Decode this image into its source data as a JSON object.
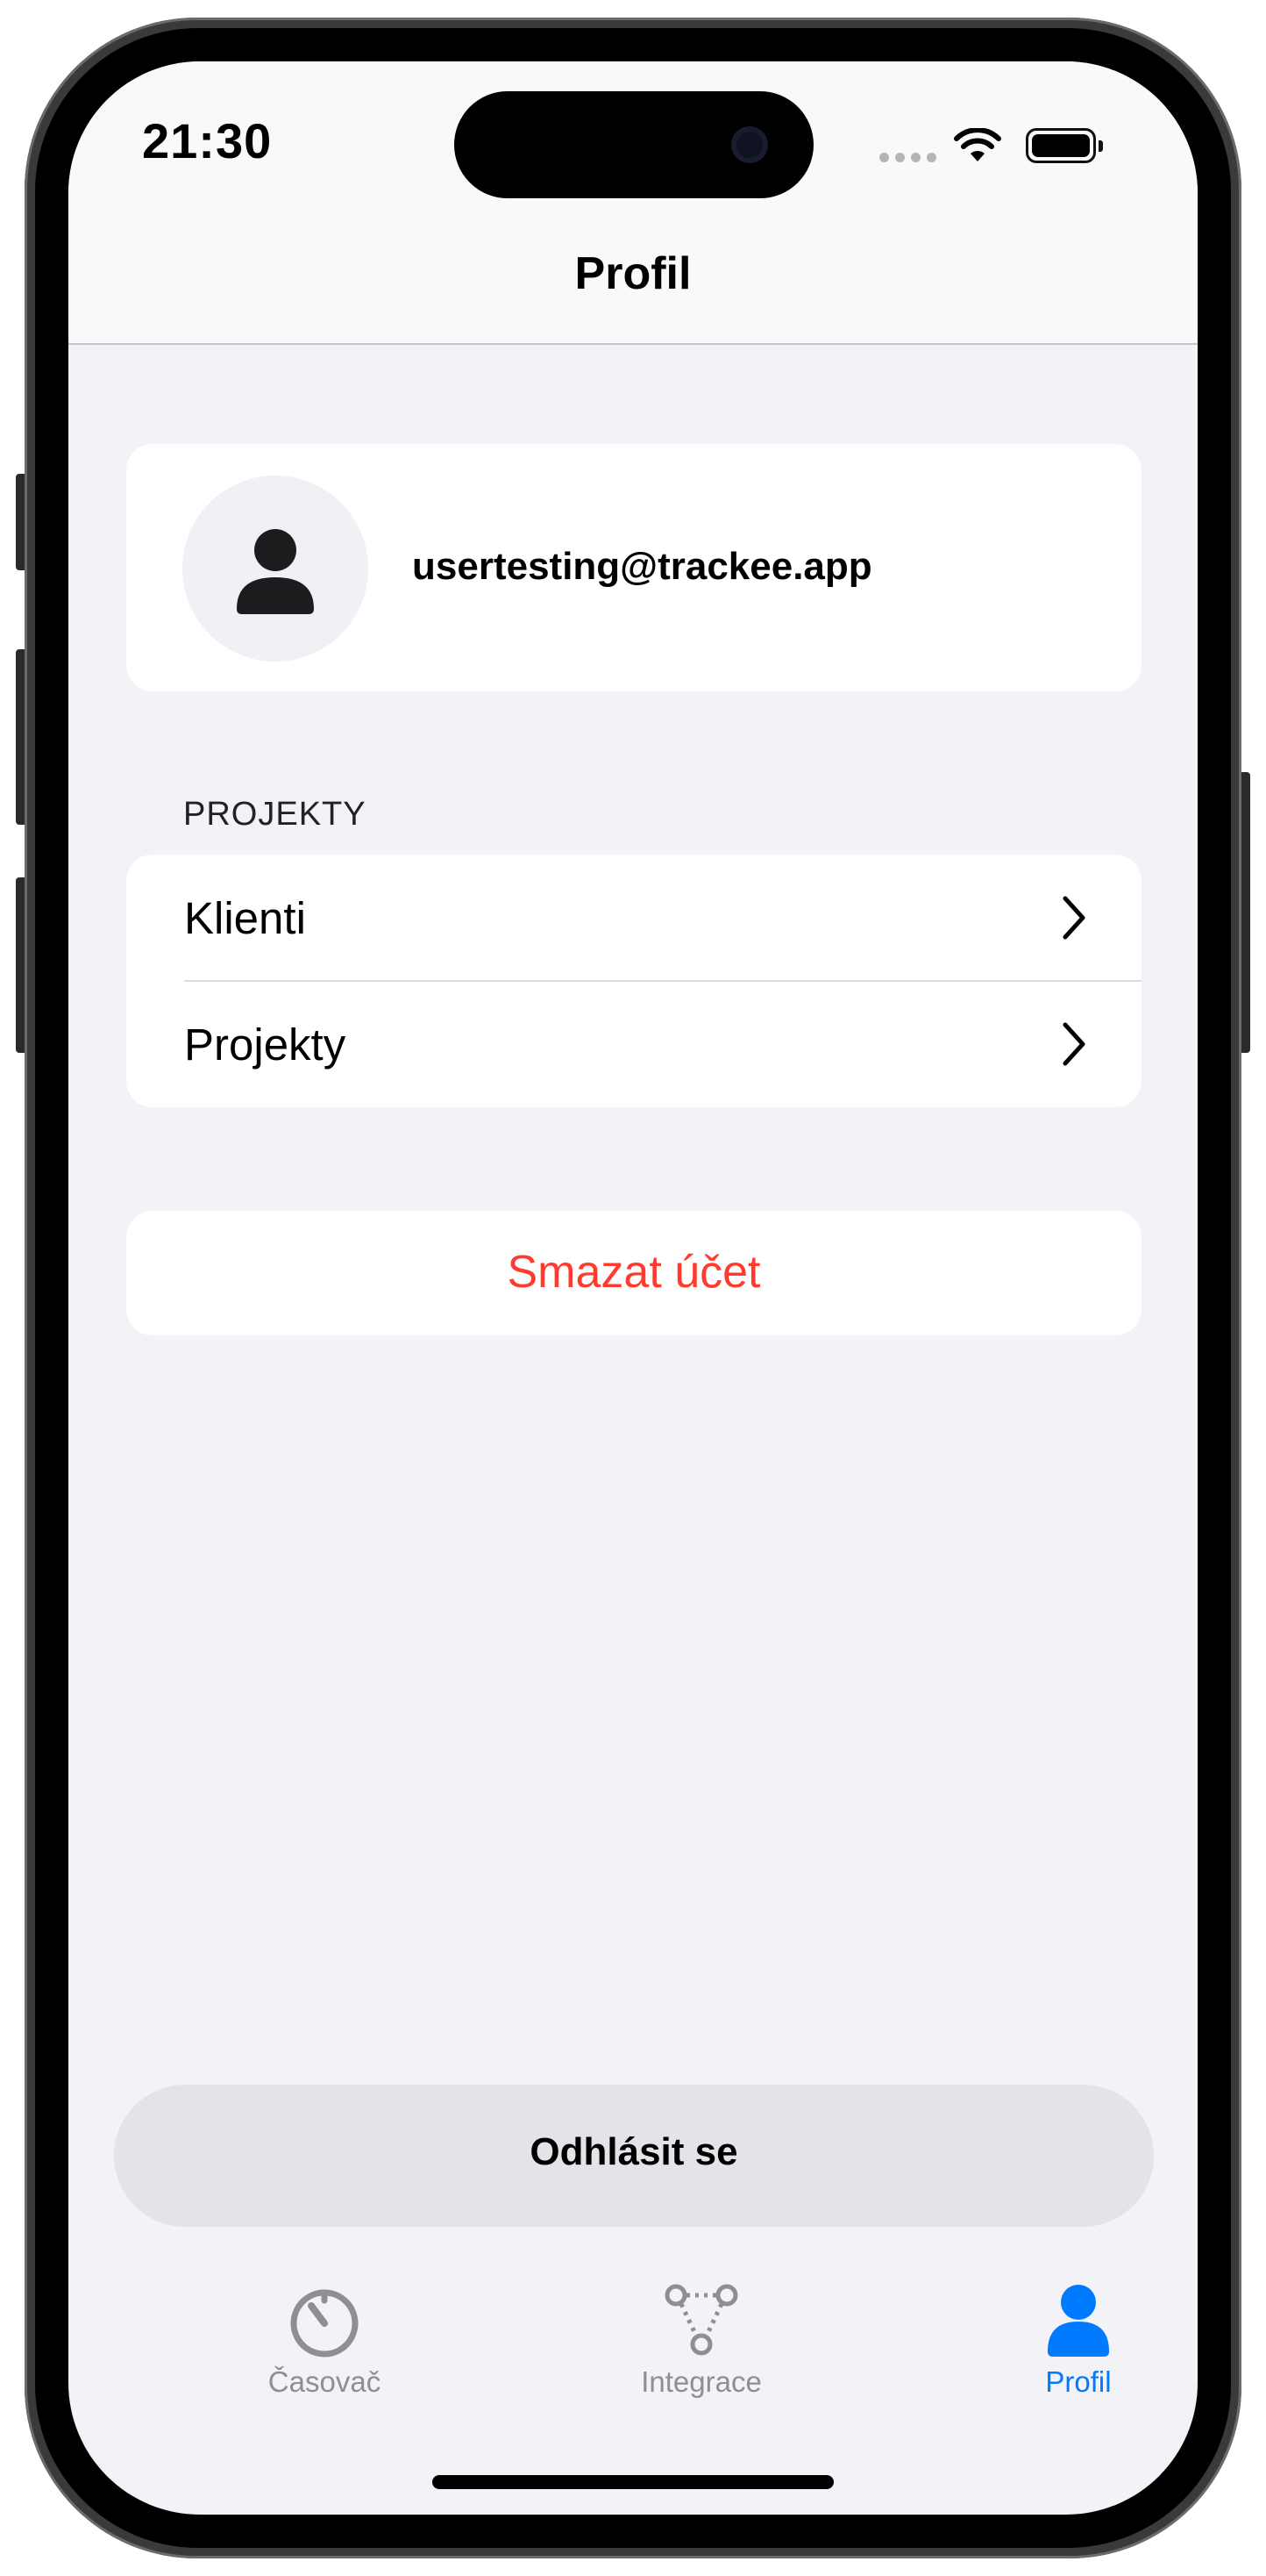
{
  "status_bar": {
    "time": "21:30"
  },
  "nav": {
    "title": "Profil"
  },
  "profile": {
    "email": "usertesting@trackee.app"
  },
  "sections": {
    "projects_header": "PROJEKTY",
    "items": [
      {
        "label": "Klienti"
      },
      {
        "label": "Projekty"
      }
    ]
  },
  "actions": {
    "delete_account": "Smazat účet",
    "logout": "Odhlásit se"
  },
  "tabbar": {
    "items": [
      {
        "label": "Časovač",
        "icon": "timer-icon"
      },
      {
        "label": "Integrace",
        "icon": "integrations-icon"
      },
      {
        "label": "Profil",
        "icon": "person-icon"
      }
    ],
    "active_index": 2
  },
  "colors": {
    "accent": "#007aff",
    "destructive": "#ff3b30",
    "background": "#f2f2f7",
    "inactive": "#8e8e93"
  }
}
